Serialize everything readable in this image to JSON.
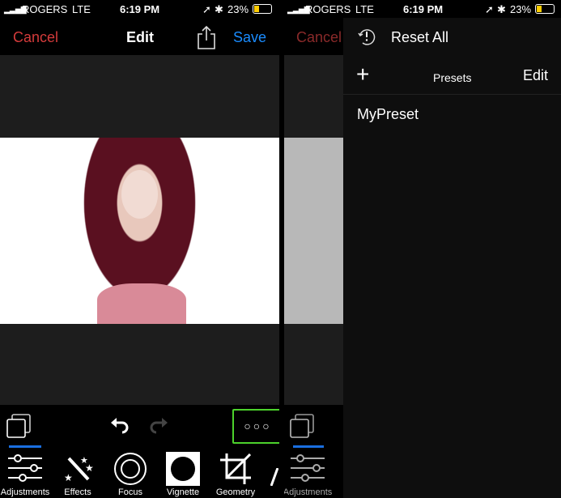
{
  "status": {
    "carrier": "ROGERS",
    "network": "LTE",
    "time": "6:19 PM",
    "battery": "23%",
    "battery_level": 0.23
  },
  "nav": {
    "cancel": "Cancel",
    "title": "Edit",
    "save": "Save"
  },
  "toolbar": {
    "tools": [
      {
        "label": "Adjustments",
        "icon": "sliders-icon"
      },
      {
        "label": "Effects",
        "icon": "magic-wand-icon"
      },
      {
        "label": "Focus",
        "icon": "focus-icon"
      },
      {
        "label": "Vignette",
        "icon": "vignette-icon"
      },
      {
        "label": "Geometry",
        "icon": "crop-icon"
      }
    ]
  },
  "menu": {
    "reset_all": "Reset All",
    "presets_title": "Presets",
    "edit": "Edit",
    "presets": [
      "MyPreset"
    ]
  },
  "colors": {
    "cancel": "#d43b3b",
    "save": "#1a8cff",
    "highlight": "#4cd22c",
    "active_tab": "#1a6fe0"
  }
}
